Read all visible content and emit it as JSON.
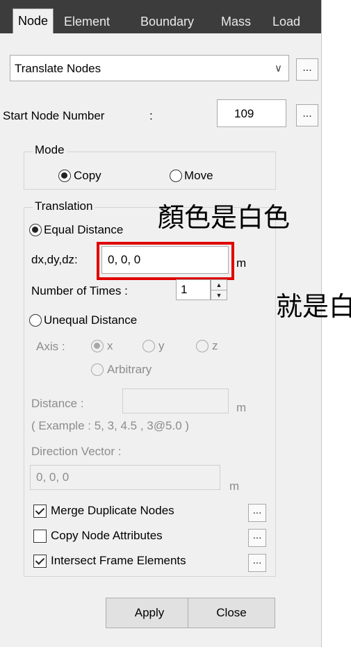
{
  "tabs": [
    "Node",
    "Element",
    "Boundary",
    "Mass",
    "Load"
  ],
  "function_select": {
    "value": "Translate Nodes"
  },
  "start_node": {
    "label": "Start Node Number",
    "separator": ":",
    "value": "109"
  },
  "mode": {
    "title": "Mode",
    "copy_label": "Copy",
    "move_label": "Move",
    "selected": "Copy"
  },
  "translation": {
    "title": "Translation",
    "equal_label": "Equal Distance",
    "dxdydz_label": "dx,dy,dz:",
    "dxdydz_value": "0, 0, 0",
    "unit": "m",
    "times_label": "Number of Times :",
    "times_value": "1",
    "unequal_label": "Unequal Distance",
    "axis_label": "Axis :",
    "axis_x": "x",
    "axis_y": "y",
    "axis_z": "z",
    "axis_arbitrary": "Arbitrary",
    "distance_label": "Distance :",
    "distance_value": "",
    "example_text": "( Example :  5, 3, 4.5 , 3@5.0 )",
    "direction_label": "Direction Vector :",
    "direction_value": "0, 0, 0"
  },
  "options": {
    "merge_label": "Merge Duplicate Nodes",
    "merge_checked": true,
    "copy_attr_label": "Copy Node Attributes",
    "copy_attr_checked": false,
    "intersect_label": "Intersect Frame Elements",
    "intersect_checked": true
  },
  "buttons": {
    "apply": "Apply",
    "close": "Close",
    "dots": "..."
  },
  "annotations": {
    "note1": "顏色是白色",
    "note2": "就是白"
  }
}
